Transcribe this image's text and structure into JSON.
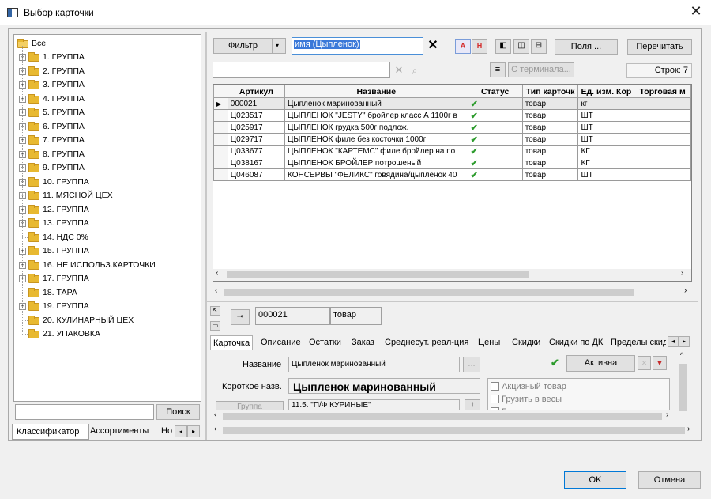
{
  "window": {
    "title": "Выбор карточки",
    "close_glyph": "✕"
  },
  "tree": {
    "root": "Все",
    "items": [
      "1. ГРУППА",
      "2. ГРУППА",
      "3. ГРУППА",
      "4. ГРУППА",
      "5. ГРУППА",
      "6. ГРУППА",
      "7. ГРУППА",
      "8. ГРУППА",
      "9. ГРУППА",
      "10. ГРУППА",
      "11. МЯСНОЙ ЦЕХ",
      "12. ГРУППА",
      "13. ГРУППА",
      "14. НДС 0%",
      "15. ГРУППА",
      "16. НЕ ИСПОЛЬЗ.КАРТОЧКИ",
      "17. ГРУППА",
      "18. ТАРА",
      "19. ГРУППА",
      "20. КУЛИНАРНЫЙ ЦЕХ",
      "21. УПАКОВКА"
    ]
  },
  "left_bottom": {
    "search_value": "",
    "search_button": "Поиск",
    "tabs": [
      "Классификатор",
      "Ассортименты",
      "Но"
    ]
  },
  "toolbar": {
    "filter_label": "Фильтр",
    "filter_value": "имя (Цыпленок)",
    "btn_a": "A",
    "btn_h": "H",
    "fields_label": "Поля ...",
    "reread_label": "Перечитать",
    "terminal_label": "С терминала...",
    "rows_label": "Строк: 7",
    "search_value": ""
  },
  "table": {
    "columns": [
      "Артикул",
      "Название",
      "Статус",
      "Тип карточк",
      "Ед. изм. Кор",
      "Торговая м"
    ],
    "rows": [
      [
        "000021",
        "Цыпленок маринованный",
        "✔",
        "товар",
        "кг",
        ""
      ],
      [
        "Ц023517",
        "ЦЫПЛЕНОК \"JESTY\" бройлер класс А 1100г в",
        "✔",
        "товар",
        "ШТ",
        ""
      ],
      [
        "Ц025917",
        "ЦЫПЛЕНОК грудка 500г подлож.",
        "✔",
        "товар",
        "ШТ",
        ""
      ],
      [
        "Ц029717",
        "ЦЫПЛЕНОК филе без косточки 1000г",
        "✔",
        "товар",
        "ШТ",
        ""
      ],
      [
        "Ц033677",
        "ЦЫПЛЕНОК \"КАРТЕМС\" филе бройлер  на по",
        "✔",
        "товар",
        "КГ",
        ""
      ],
      [
        "Ц038167",
        "ЦЫПЛЕНОК БРОЙЛЕР потрошеный",
        "✔",
        "товар",
        "КГ",
        ""
      ],
      [
        "Ц046087",
        "КОНСЕРВЫ \"ФЕЛИКС\" говядина/цыпленок 40",
        "✔",
        "товар",
        "ШТ",
        ""
      ]
    ]
  },
  "detail": {
    "code": "000021",
    "type": "товар",
    "tabs": [
      "Карточка",
      "Описание",
      "Остатки",
      "Заказ",
      "Среднесут. реал-ция",
      "Цены",
      "Скидки",
      "Скидки по ДК",
      "Пределы скид"
    ],
    "name_label": "Название",
    "name_value": "Цыпленок маринованный",
    "short_label": "Короткое назв.",
    "short_value": "Цыпленок маринованный",
    "group_label": "Группа",
    "group_value": "11.5. \"П/Ф КУРИНЫЕ\"",
    "active_label": "Активна",
    "ellipsis": "...",
    "checks": [
      "Акцизный товар",
      "Грузить в весы",
      "Б"
    ]
  },
  "footer": {
    "ok": "OK",
    "cancel": "Отмена"
  }
}
